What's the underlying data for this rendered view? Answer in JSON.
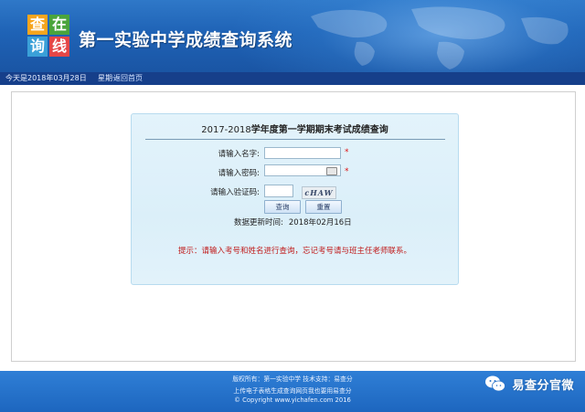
{
  "header": {
    "logo_chars": [
      "查",
      "在",
      "询",
      "线"
    ],
    "title": "第一实验中学成绩查询系统"
  },
  "datebar": {
    "date": "今天是2018年03月28日",
    "weekday": "星期一",
    "home_link": "返回首页"
  },
  "query_panel": {
    "title_year": "2017-2018",
    "title_rest": "学年度第一学期期末考试成绩查询",
    "name_label": "请输入名字:",
    "name_value": "",
    "password_label": "请输入密码:",
    "password_value": "",
    "code_label": "请输入验证码:",
    "code_value": "",
    "captcha_text": "cHAW",
    "required_mark": "*",
    "query_button": "查询",
    "reset_button": "重置",
    "update_label": "数据更新时间:",
    "update_value": "2018年02月16日",
    "hint": "提示：请输入考号和姓名进行查询，忘记考号请与班主任老师联系。"
  },
  "footer": {
    "line1": "版权所有：第一实验中学  技术支持：易查分",
    "line2": "上传电子表格生成查询网页我也要用易查分",
    "line3": "© Copyright www.yichafen.com 2016"
  },
  "watermark": {
    "text": "易查分官微",
    "icon": "wechat-icon"
  },
  "colors": {
    "header_blue": "#1f63b6",
    "datebar": "#163f8a",
    "panel_bg": "#dbeff9",
    "hint_red": "#c01a1a",
    "required_red": "#dd1111",
    "footer_blue": "#2372c8"
  }
}
